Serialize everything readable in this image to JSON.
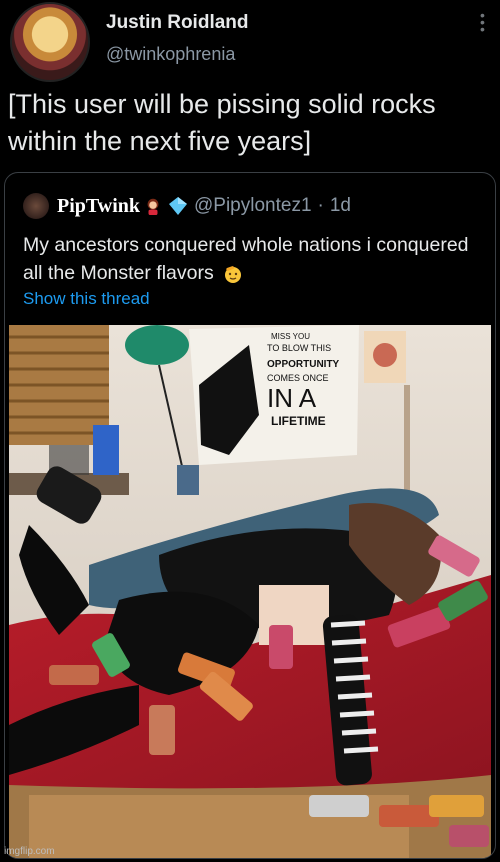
{
  "tweet": {
    "author_name": "Justin Roidland",
    "author_handle": "@twinkophrenia",
    "text": "[This user will be pissing solid rocks within the next five years]"
  },
  "quote": {
    "author_name": "PipTwink",
    "author_handle": "@Pipylontez1",
    "time": "1d",
    "separator": "·",
    "text": "My ancestors conquered whole nations i conquered all the Monster flavors",
    "show_thread": "Show this thread"
  },
  "poster": {
    "line1": "MISS YOU",
    "line2": "TO BLOW THIS",
    "line3": "OPPORTUNITY",
    "line4": "COMES ONCE",
    "line5": "IN A",
    "line6": "LIFETIME"
  },
  "watermark": "imgflip.com",
  "colors": {
    "background": "#000000",
    "text": "#e7e9ea",
    "secondary": "#8b98a5",
    "link": "#1d9bf0",
    "verified": "#1d9bf0"
  },
  "icons": {
    "more": "more-icon",
    "verified": "verified-icon",
    "emoji_girl": "girl-emoji-icon",
    "emoji_face": "saluting-face-icon"
  }
}
